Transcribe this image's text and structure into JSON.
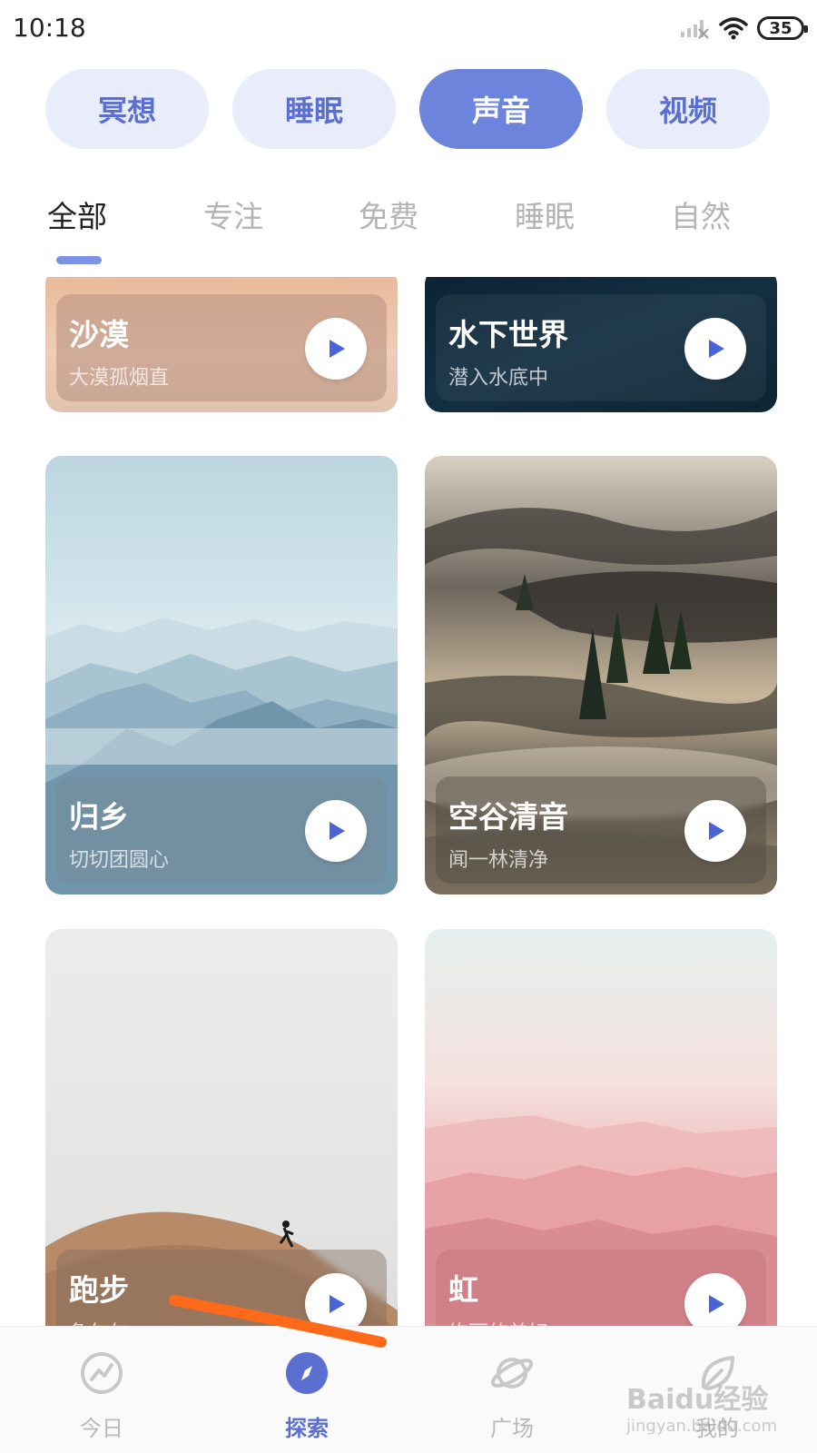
{
  "status_bar": {
    "time": "10:18",
    "battery": "35"
  },
  "categories": [
    {
      "label": "冥想",
      "active": false
    },
    {
      "label": "睡眠",
      "active": false
    },
    {
      "label": "声音",
      "active": true
    },
    {
      "label": "视频",
      "active": false
    }
  ],
  "subtabs": [
    {
      "label": "全部",
      "active": true
    },
    {
      "label": "专注",
      "active": false
    },
    {
      "label": "免费",
      "active": false
    },
    {
      "label": "睡眠",
      "active": false
    },
    {
      "label": "自然",
      "active": false
    }
  ],
  "cards": [
    {
      "title": "沙漠",
      "subtitle": "大漠孤烟直"
    },
    {
      "title": "水下世界",
      "subtitle": "潜入水底中"
    },
    {
      "title": "归乡",
      "subtitle": "切切团圆心"
    },
    {
      "title": "空谷清音",
      "subtitle": "闻一林清净"
    },
    {
      "title": "跑步",
      "subtitle": "急匆匆"
    },
    {
      "title": "虹",
      "subtitle": "绚丽的美好"
    }
  ],
  "bottom_nav": [
    {
      "label": "今日",
      "icon": "trend-icon",
      "active": false
    },
    {
      "label": "探索",
      "icon": "compass-icon",
      "active": true
    },
    {
      "label": "广场",
      "icon": "planet-icon",
      "active": false
    },
    {
      "label": "我的",
      "icon": "leaf-icon",
      "active": false
    }
  ],
  "watermark": {
    "text": "Baidu经验",
    "sub": "jingyan.baidu.com"
  },
  "colors": {
    "accent": "#6c84dc",
    "pill_bg": "#e9edfb",
    "pill_text": "#5a6fd0",
    "play_triangle": "#4a64d8",
    "annotation": "#ff6a1a"
  }
}
